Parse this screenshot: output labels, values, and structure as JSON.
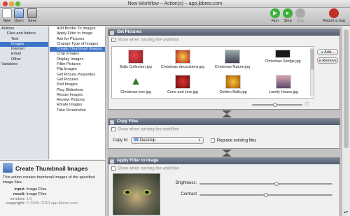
{
  "window": {
    "title": "New Workflow – Action(s) – app.jbbres.com"
  },
  "toolbar": {
    "new": "New",
    "open": "Open",
    "save": "Save",
    "run": "Run",
    "step": "Step",
    "stop": "Stop",
    "report": "Report a bug"
  },
  "library": {
    "items": [
      {
        "label": "Actions"
      },
      {
        "label": "Files and folders"
      },
      {
        "label": "Text"
      },
      {
        "label": "Images"
      },
      {
        "label": "Internet"
      },
      {
        "label": "Email"
      },
      {
        "label": "Other"
      },
      {
        "label": "Variables"
      }
    ]
  },
  "actions": {
    "items": [
      "Add Border To Images",
      "Apply Filter to Image",
      "Ask for Pictures",
      "Change Type of Images",
      "Create Thumbnail Images",
      "Crop Images",
      "Display Images",
      "Filter Pictures",
      "Flip Images",
      "Get Picture Properties",
      "Get Pictures",
      "Pad Images",
      "Play Slideshow",
      "Resize Images",
      "Review Pictures",
      "Rotate Images",
      "Take Screenshot"
    ],
    "selected": "Create Thumbnail Images"
  },
  "info": {
    "title": "Create Thumbnail Images",
    "description": "This action creates thumbnail images of the specified image files.",
    "input_label": "input:",
    "input_value": "Image Files",
    "result_label": "result:",
    "result_value": "Image Files",
    "version_label": "version:",
    "version_value": "1.0",
    "copyright_label": "copyright:",
    "copyright_value": "© 2009–2010 app.jbbres.com"
  },
  "get_pictures": {
    "title": "Get Pictures",
    "show_label": "Show when running the workflow",
    "add": "Add...",
    "remove": "Remove",
    "files": [
      "Balls Collection.jpg",
      "Christmas decorations.jpg",
      "Christmas Nature.jpg",
      "Christmas Sledge.jpg",
      "Christmas tree.jpg",
      "Cone and Line.jpg",
      "Golden Balls.jpg",
      "Lonely House.jpg"
    ]
  },
  "copy_files": {
    "title": "Copy Files",
    "show_label": "Show when running the workflow",
    "copy_to_label": "Copy to:",
    "destination": "Desktop",
    "replace_label": "Replace existing files"
  },
  "apply_filter": {
    "title": "Apply Filter to Image",
    "show_label": "Show when running the workflow",
    "brightness_label": "Brightness:",
    "contrast_label": "Contrast",
    "brightness": 0.58,
    "contrast": 0.5
  }
}
